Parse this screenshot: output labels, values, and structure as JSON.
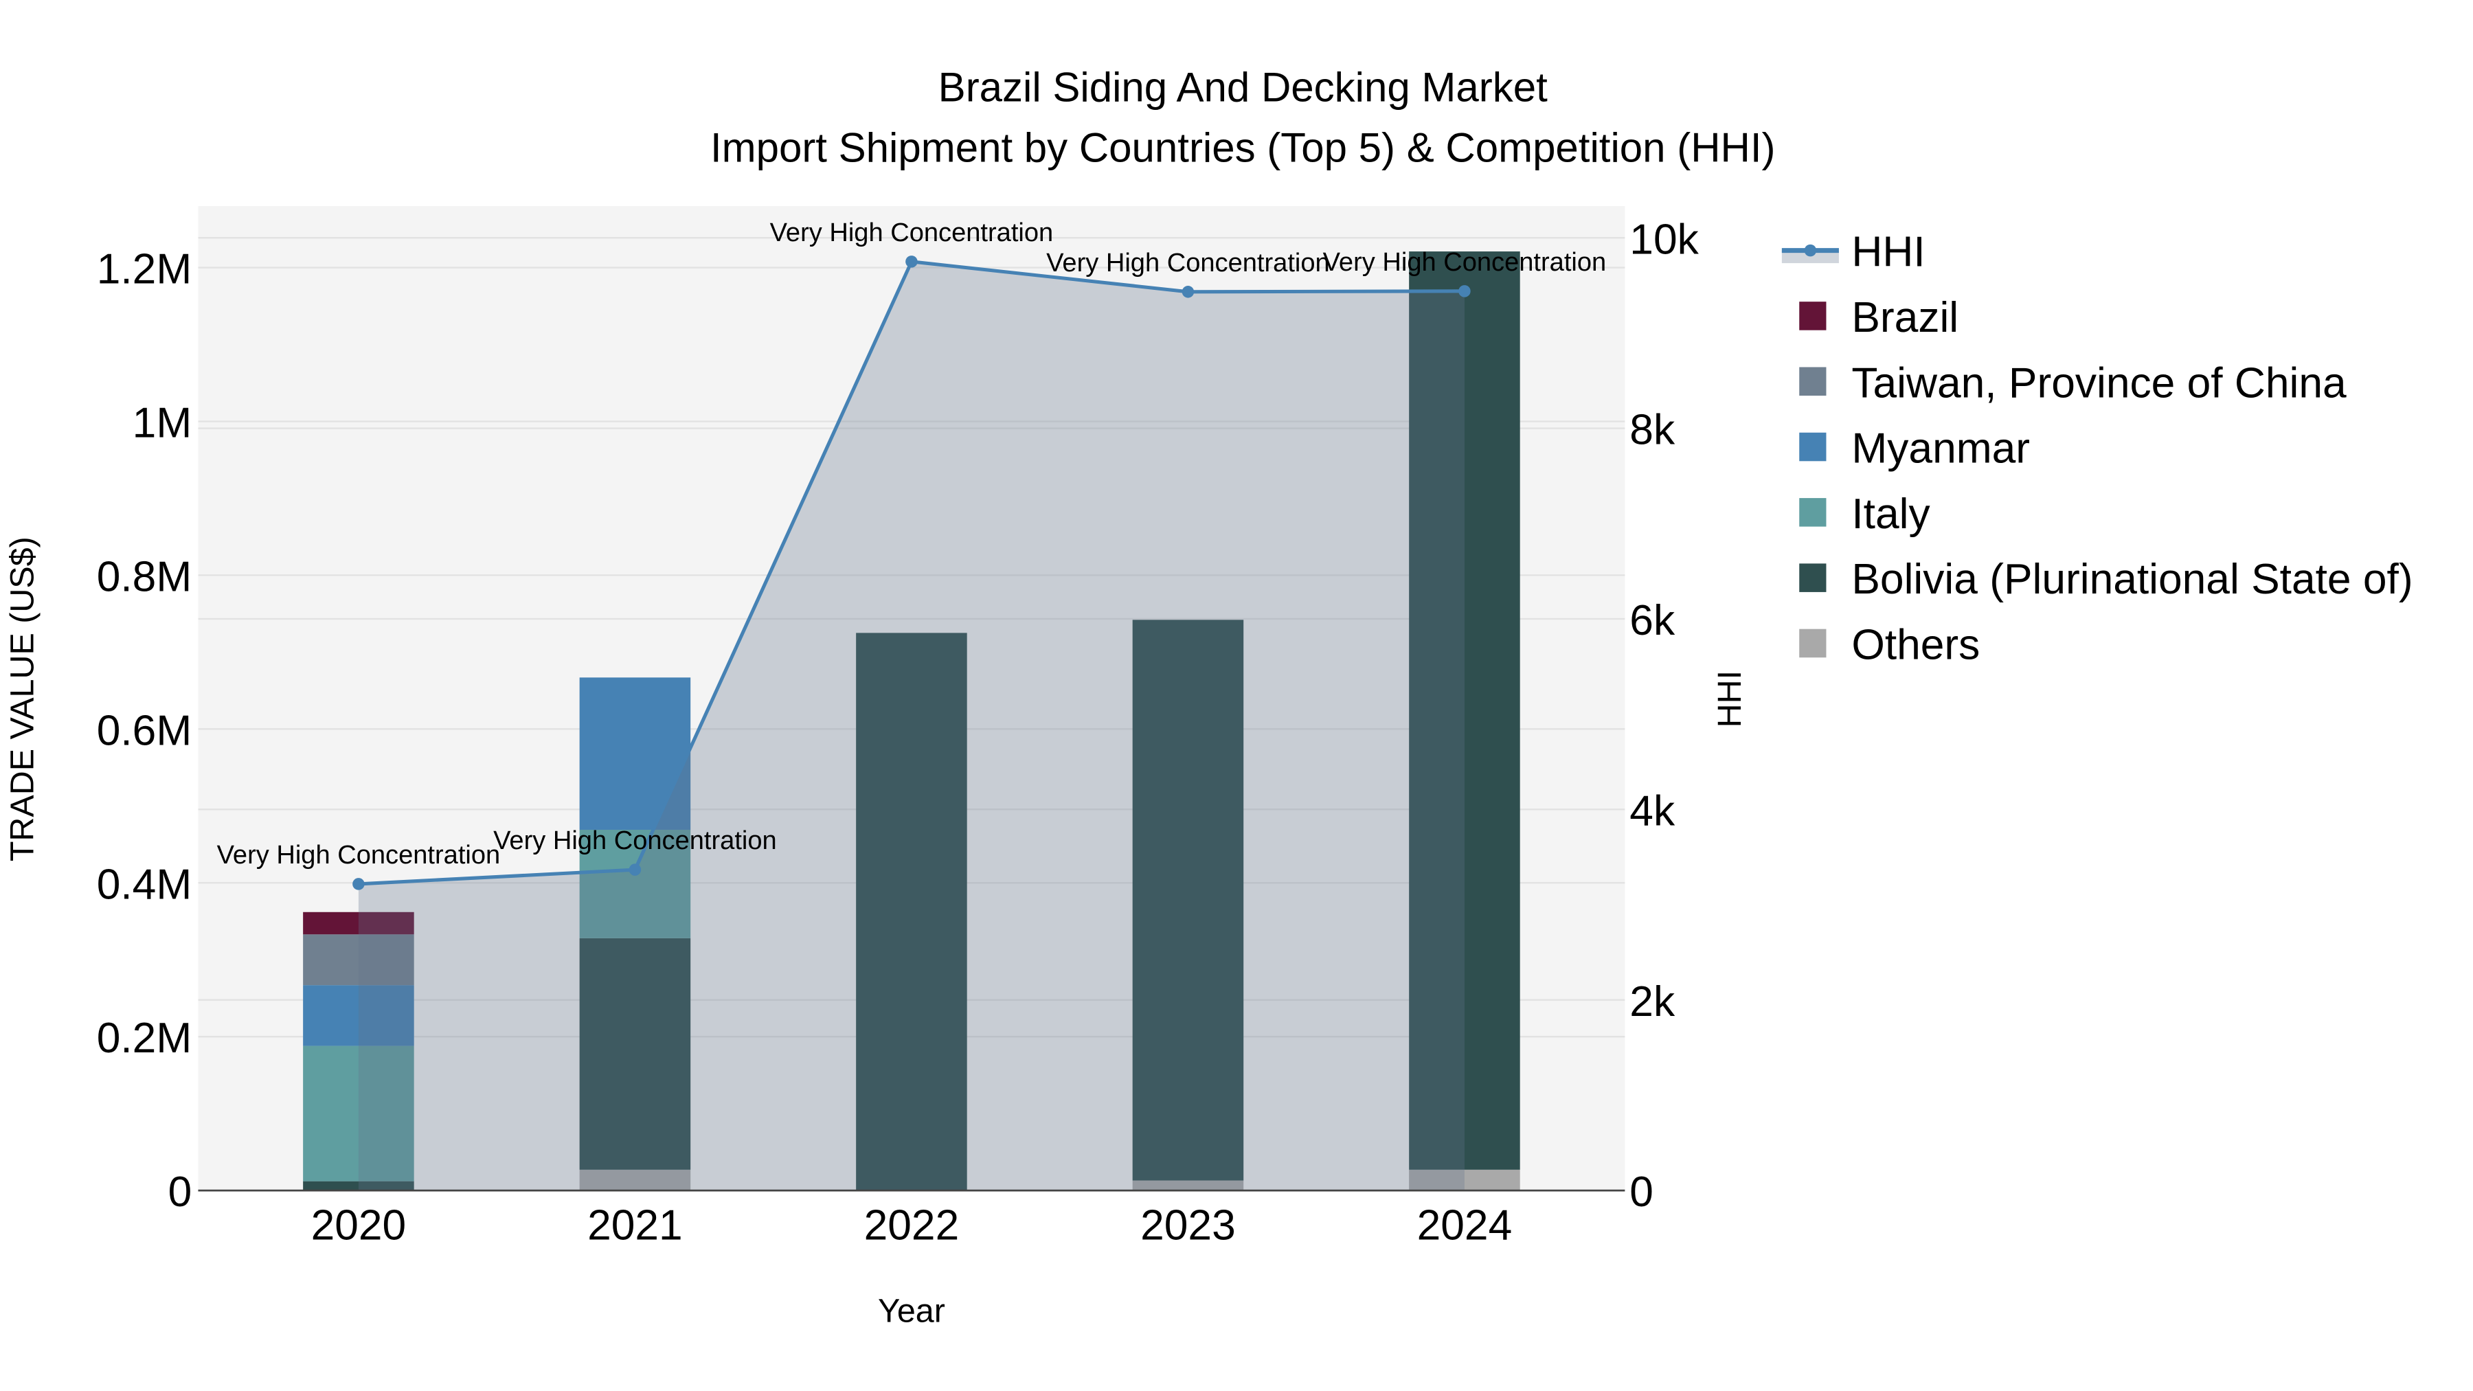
{
  "chart_data": {
    "type": "bar",
    "title": "Brazil Siding And Decking Market",
    "subtitle": "Import Shipment by Countries (Top 5) & Competition (HHI)",
    "xlabel": "Year",
    "ylabel": "TRADE VALUE (US$)",
    "y2label": "HHI",
    "categories": [
      "2020",
      "2021",
      "2022",
      "2023",
      "2024"
    ],
    "ylim": [
      0,
      1280000
    ],
    "y2lim": [
      0,
      10333
    ],
    "yticks": [
      {
        "v": 0,
        "label": "0"
      },
      {
        "v": 200000,
        "label": "0.2M"
      },
      {
        "v": 400000,
        "label": "0.4M"
      },
      {
        "v": 600000,
        "label": "0.6M"
      },
      {
        "v": 800000,
        "label": "0.8M"
      },
      {
        "v": 1000000,
        "label": "1M"
      },
      {
        "v": 1200000,
        "label": "1.2M"
      }
    ],
    "y2ticks": [
      {
        "v": 0,
        "label": "0"
      },
      {
        "v": 2000,
        "label": "2k"
      },
      {
        "v": 4000,
        "label": "4k"
      },
      {
        "v": 6000,
        "label": "6k"
      },
      {
        "v": 8000,
        "label": "8k"
      },
      {
        "v": 10000,
        "label": "10k"
      }
    ],
    "grid": true,
    "legend_position": "right",
    "stack_order": [
      "Others",
      "Bolivia (Plurinational State of)",
      "Italy",
      "Myanmar",
      "Taiwan, Province of China",
      "Brazil"
    ],
    "series": [
      {
        "name": "Brazil",
        "color": "#631437",
        "values": [
          29000,
          0,
          0,
          0,
          0
        ]
      },
      {
        "name": "Taiwan, Province of China",
        "color": "#708090",
        "values": [
          66000,
          0,
          0,
          0,
          0
        ]
      },
      {
        "name": "Myanmar",
        "color": "#4682b4",
        "values": [
          79000,
          198000,
          0,
          0,
          0
        ]
      },
      {
        "name": "Italy",
        "color": "#5f9ea0",
        "values": [
          176000,
          141000,
          0,
          0,
          0
        ]
      },
      {
        "name": "Bolivia (Plurinational State of)",
        "color": "#2f4f4f",
        "values": [
          12000,
          301000,
          725000,
          729000,
          1194000
        ]
      },
      {
        "name": "Others",
        "color": "#a9a9a9",
        "values": [
          0,
          27000,
          0,
          13000,
          27000
        ]
      }
    ],
    "hhi": {
      "name": "HHI",
      "color": "#4682b4",
      "values": [
        3217,
        3367,
        9750,
        9433,
        9440
      ],
      "annotations": [
        "Very High Concentration",
        "Very High Concentration",
        "Very High Concentration",
        "Very High Concentration",
        "Very High Concentration"
      ]
    }
  }
}
